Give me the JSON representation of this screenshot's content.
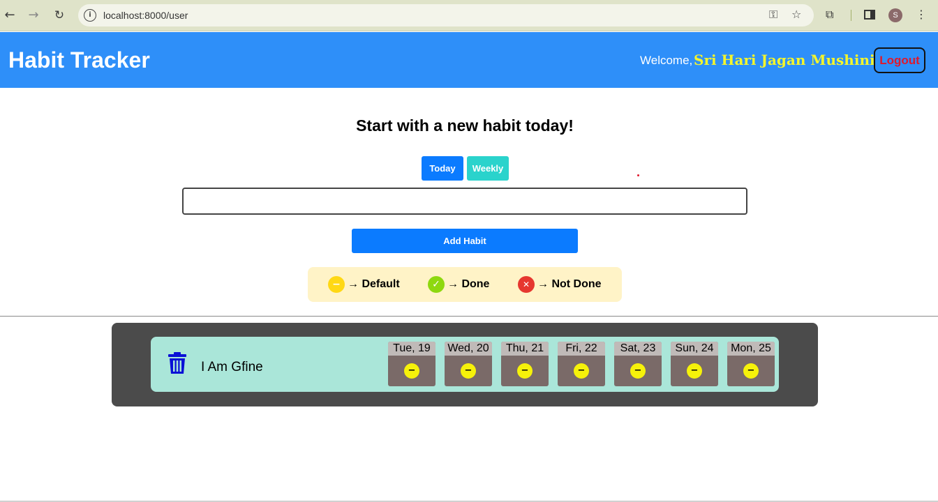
{
  "browser": {
    "url": "localhost:8000/user",
    "profile_initial": "S"
  },
  "header": {
    "title": "Habit Tracker",
    "welcome_label": "Welcome,",
    "username": "Sri Hari Jagan Mushini",
    "logout_label": "Logout"
  },
  "main": {
    "headline": "Start with a new habit today!",
    "tabs": [
      {
        "label": "Today",
        "active": true
      },
      {
        "label": "Weekly",
        "active": false
      }
    ],
    "habit_input_value": "",
    "add_button_label": "Add Habit",
    "legend": [
      {
        "icon": "minus-circle-icon",
        "color": "#ffd814",
        "text": "→ Default"
      },
      {
        "icon": "check-circle-icon",
        "color": "#8ed80f",
        "text": "→ Done"
      },
      {
        "icon": "x-circle-icon",
        "color": "#e6372f",
        "text": "→ Not Done"
      }
    ]
  },
  "habits": [
    {
      "name": "I Am Gfine",
      "days": [
        {
          "label": "Tue, 19",
          "status": "default"
        },
        {
          "label": "Wed, 20",
          "status": "default"
        },
        {
          "label": "Thu, 21",
          "status": "default"
        },
        {
          "label": "Fri, 22",
          "status": "default"
        },
        {
          "label": "Sat, 23",
          "status": "default"
        },
        {
          "label": "Sun, 24",
          "status": "default"
        },
        {
          "label": "Mon, 25",
          "status": "default"
        }
      ]
    }
  ],
  "colors": {
    "header_bg": "#2e8ff9",
    "primary_button": "#0b7bff",
    "weekly_button": "#2ad3cc",
    "username": "#f4f52c",
    "logout_text": "#e0192d",
    "legend_bg": "#fff3c7",
    "panel_bg": "#4b4b4b",
    "card_bg": "#aae6d9",
    "default_status": "#f6f20a"
  }
}
